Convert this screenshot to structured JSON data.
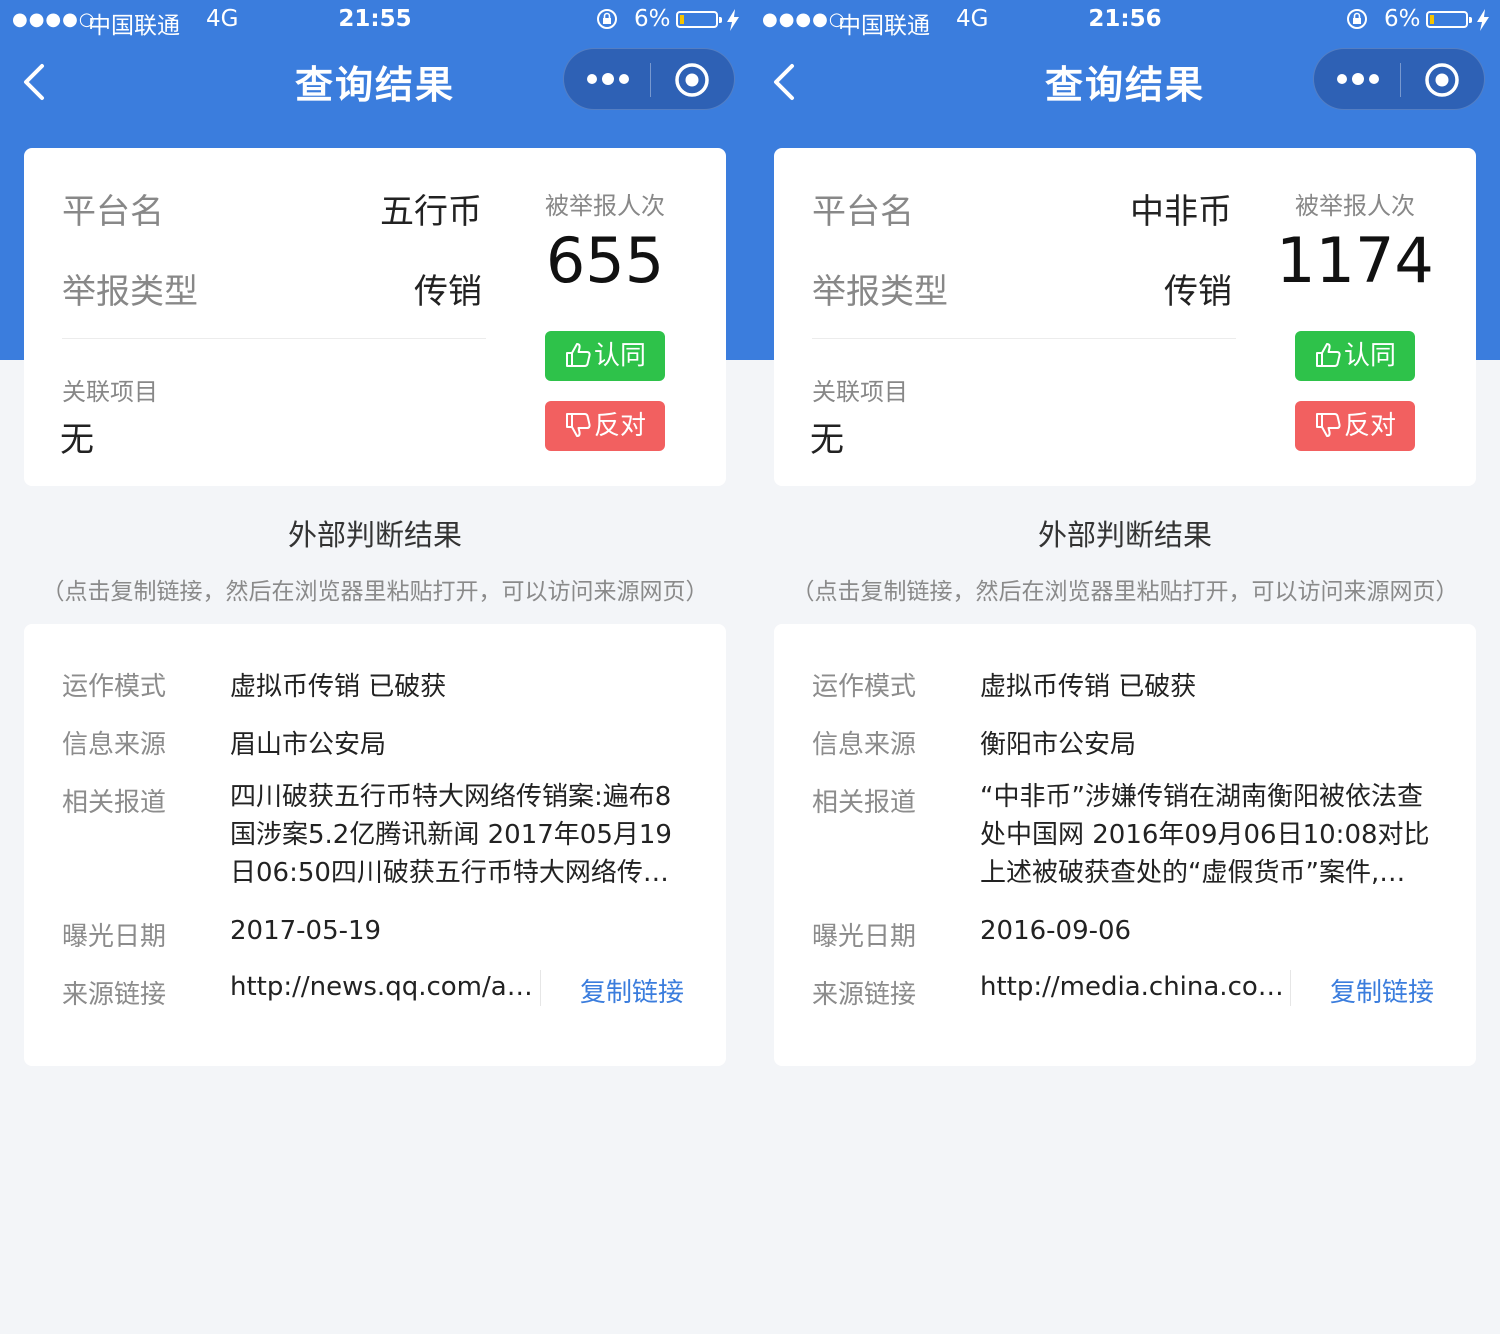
{
  "status_bar_left": {
    "signal": "●●●●○",
    "carrier": "中国联通",
    "network": "4G",
    "time": "21:55",
    "battery": "6%"
  },
  "status_bar_right": {
    "signal": "●●●●○",
    "carrier": "中国联通",
    "network": "4G",
    "time": "21:56",
    "battery": "6%"
  },
  "left": {
    "nav_title": "查询结果",
    "platform_label": "平台名",
    "platform_value": "五行币",
    "type_label": "举报类型",
    "type_value": "传销",
    "related_label": "关联项目",
    "related_value": "无",
    "reported_label": "被举报人次",
    "reported_count": "655",
    "agree_label": "认同",
    "oppose_label": "反对",
    "section_title": "外部判断结果",
    "section_hint": "（点击复制链接，然后在浏览器里粘贴打开，可以访问来源网页）",
    "mode_label": "运作模式",
    "mode_value": "虚拟币传销 已破获",
    "source_label": "信息来源",
    "source_value": "眉山市公安局",
    "news_label": "相关报道",
    "news_value": "四川破获五行币特大网络传销案:遍布8国涉案5.2亿腾讯新闻   2017年05月19日06:50四川破获五行币特大网络传…",
    "date_label": "曝光日期",
    "date_value": "2017-05-19",
    "link_label": "来源链接",
    "link_value": "http://news.qq.com/a…",
    "copy_label": "复制链接"
  },
  "right": {
    "nav_title": "查询结果",
    "platform_label": "平台名",
    "platform_value": "中非币",
    "type_label": "举报类型",
    "type_value": "传销",
    "related_label": "关联项目",
    "related_value": "无",
    "reported_label": "被举报人次",
    "reported_count": "1174",
    "agree_label": "认同",
    "oppose_label": "反对",
    "section_title": "外部判断结果",
    "section_hint": "（点击复制链接，然后在浏览器里粘贴打开，可以访问来源网页）",
    "mode_label": "运作模式",
    "mode_value": "虚拟币传销 已破获",
    "source_label": "信息来源",
    "source_value": "衡阳市公安局",
    "news_label": "相关报道",
    "news_value": "“中非币”涉嫌传销在湖南衡阳被依法查处中国网   2016年09月06日10:08对比上述被破获查处的“虚假货币”案件,…",
    "date_label": "曝光日期",
    "date_value": "2016-09-06",
    "link_label": "来源链接",
    "link_value": "http://media.china.co…",
    "copy_label": "复制链接"
  },
  "colors": {
    "primary_blue": "#3b7ddd",
    "agree_green": "#2ec24a",
    "oppose_red": "#f26060",
    "page_bg": "#f3f5f8"
  },
  "icons": [
    "back-arrow-icon",
    "more-dots-icon",
    "target-icon",
    "rotation-lock-icon",
    "battery-icon",
    "charging-bolt-icon",
    "thumbs-up-icon",
    "thumbs-down-icon"
  ]
}
